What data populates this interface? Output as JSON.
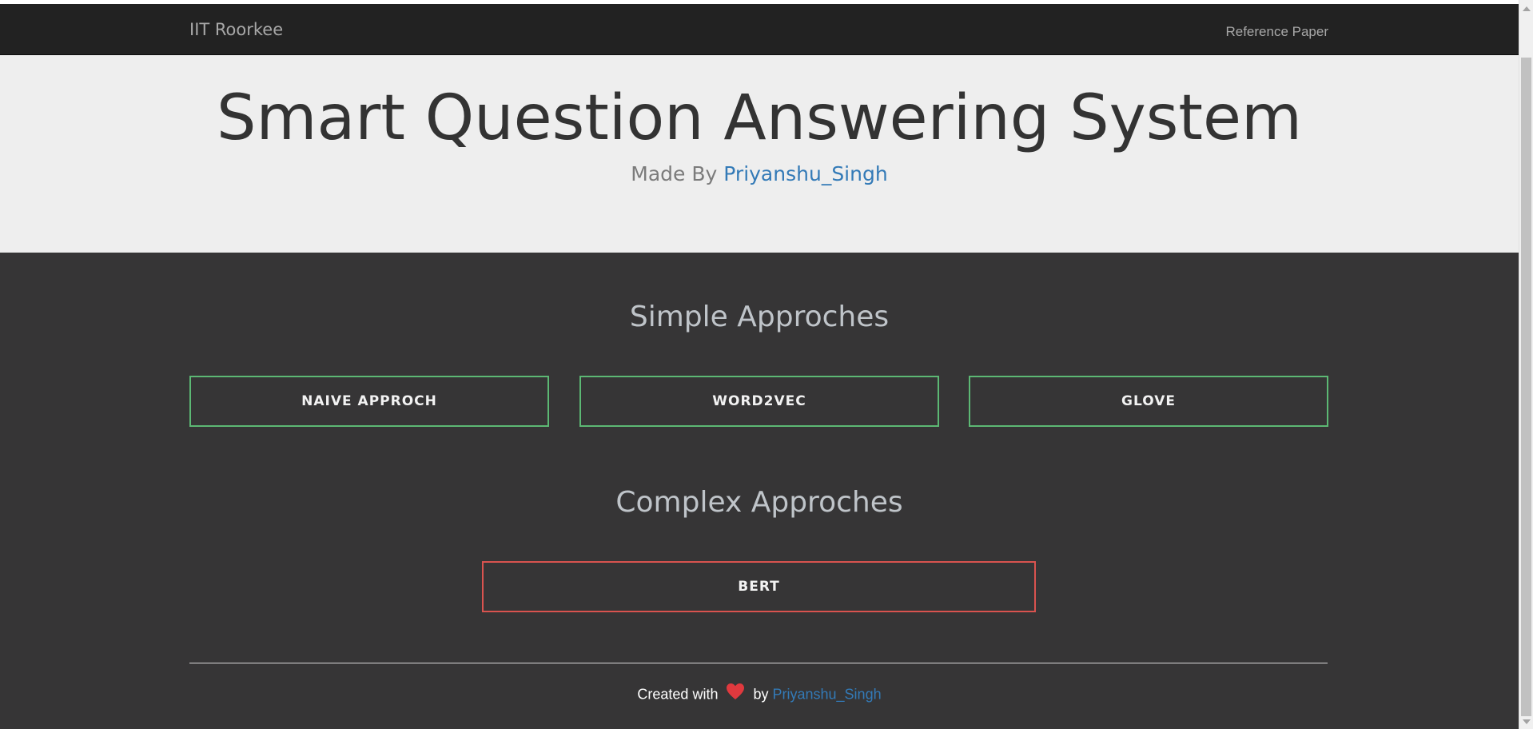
{
  "navbar": {
    "brand": "IIT Roorkee",
    "link": "Reference Paper"
  },
  "hero": {
    "title": "Smart Question Answering System",
    "made_by_prefix": "Made By",
    "author": "Priyanshu_Singh"
  },
  "simple": {
    "heading": "Simple Approches",
    "buttons": [
      "NAIVE APPROCH",
      "WORD2VEC",
      "GLOVE"
    ]
  },
  "complex": {
    "heading": "Complex Approches",
    "buttons": [
      "BERT"
    ]
  },
  "footer": {
    "prefix": "Created with",
    "by": "by",
    "author": "Priyanshu_Singh"
  },
  "colors": {
    "simple_border": "#5cb874",
    "complex_border": "#d9534f",
    "link": "#337ab7",
    "heart": "#e0393e"
  }
}
